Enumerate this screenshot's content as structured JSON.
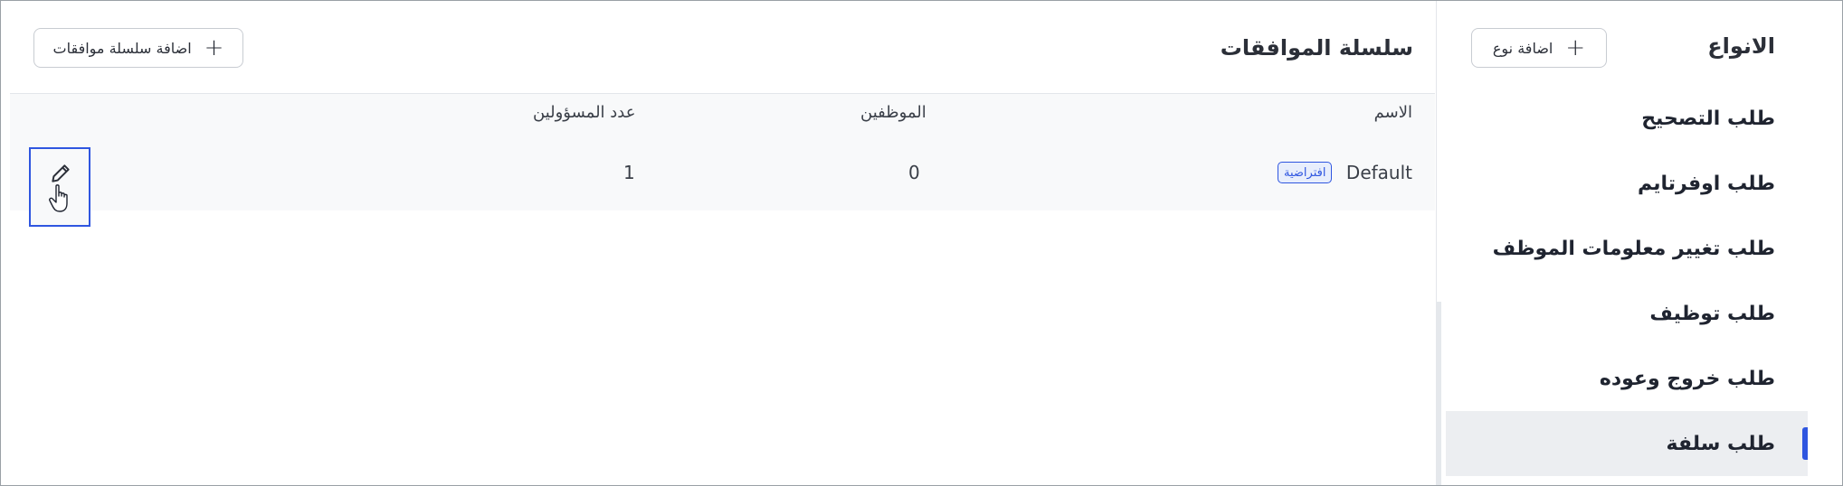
{
  "types_panel": {
    "title": "الانواع",
    "add_button_label": "اضافة نوع",
    "items": [
      {
        "label": "طلب التصحيح",
        "active": false
      },
      {
        "label": "طلب اوفرتايم",
        "active": false
      },
      {
        "label": "طلب تغيير معلومات الموظف",
        "active": false
      },
      {
        "label": "طلب توظيف",
        "active": false
      },
      {
        "label": "طلب خروج وعوده",
        "active": false
      },
      {
        "label": "طلب سلفة",
        "active": true
      }
    ]
  },
  "main": {
    "title": "سلسلة الموافقات",
    "add_chain_label": "اضافة سلسلة موافقات",
    "columns": {
      "name": "الاسم",
      "employees": "الموظفين",
      "responsible_count": "عدد المسؤولين"
    },
    "rows": [
      {
        "name": "Default",
        "badge": "افتراضية",
        "employees": "0",
        "responsible_count": "1"
      }
    ]
  },
  "colors": {
    "accent": "#2f56e0",
    "active_bg": "#eceef1",
    "badge_bg": "#e8eefc"
  },
  "icons": {
    "plus": "plus-icon",
    "edit": "pencil-icon",
    "cursor": "hand-pointer-icon"
  }
}
